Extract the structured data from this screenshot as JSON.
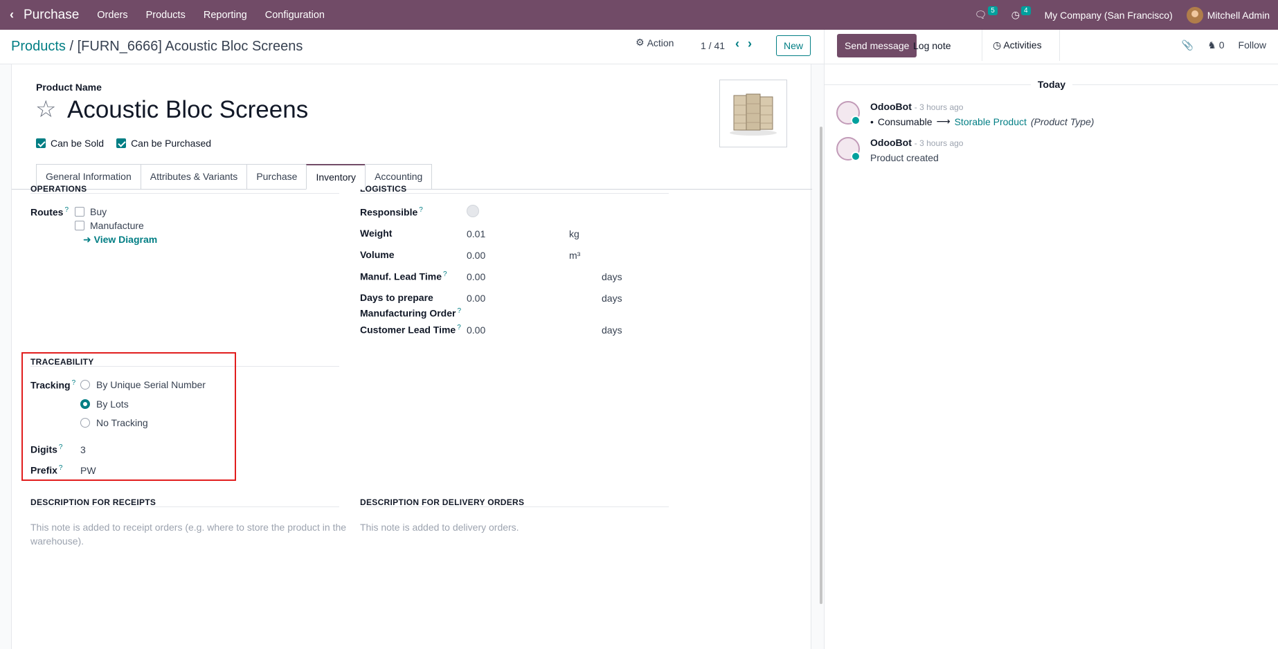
{
  "navbar": {
    "app_name": "Purchase",
    "menu": [
      "Orders",
      "Products",
      "Reporting",
      "Configuration"
    ],
    "messages_count": "5",
    "activities_count": "4",
    "company": "My Company (San Francisco)",
    "user": "Mitchell Admin"
  },
  "control": {
    "breadcrumb_parent": "Products",
    "breadcrumb_separator": "/",
    "breadcrumb_current": "[FURN_6666] Acoustic Bloc Screens",
    "action_label": "Action",
    "pager": "1 / 41",
    "new_label": "New"
  },
  "product": {
    "name_label": "Product Name",
    "name": "Acoustic Bloc Screens",
    "can_be_sold": "Can be Sold",
    "can_be_purchased": "Can be Purchased"
  },
  "tabs": [
    "General Information",
    "Attributes & Variants",
    "Purchase",
    "Inventory",
    "Accounting"
  ],
  "operations": {
    "title": "OPERATIONS",
    "routes_label": "Routes",
    "route_buy": "Buy",
    "route_manufacture": "Manufacture",
    "view_diagram": "View Diagram"
  },
  "logistics": {
    "title": "LOGISTICS",
    "responsible_label": "Responsible",
    "weight_label": "Weight",
    "weight_value": "0.01",
    "weight_unit": "kg",
    "volume_label": "Volume",
    "volume_value": "0.00",
    "volume_unit": "m³",
    "manuf_lead_label": "Manuf. Lead Time",
    "manuf_lead_value": "0.00",
    "days": "days",
    "days_prepare_label_1": "Days to prepare",
    "days_prepare_label_2": "Manufacturing Order",
    "days_prepare_value": "0.00",
    "customer_lead_label": "Customer Lead Time",
    "customer_lead_value": "0.00"
  },
  "traceability": {
    "title": "TRACEABILITY",
    "tracking_label": "Tracking",
    "opt_serial": "By Unique Serial Number",
    "opt_lots": "By Lots",
    "opt_none": "No Tracking",
    "digits_label": "Digits",
    "digits_value": "3",
    "prefix_label": "Prefix",
    "prefix_value": "PW"
  },
  "descriptions": {
    "receipts_title": "DESCRIPTION FOR RECEIPTS",
    "receipts_placeholder_1": "This note is added to receipt orders (e.g. where to store the product in the",
    "receipts_placeholder_2": "warehouse).",
    "delivery_title": "DESCRIPTION FOR DELIVERY ORDERS",
    "delivery_placeholder": "This note is added to delivery orders."
  },
  "chatter": {
    "send_message": "Send message",
    "log_note": "Log note",
    "activities": "Activities",
    "attachments_count": "0",
    "follow": "Follow",
    "today": "Today",
    "messages": [
      {
        "author": "OdooBot",
        "time": "- 3 hours ago",
        "old_value": "Consumable",
        "new_value": "Storable Product",
        "field": "(Product Type)"
      },
      {
        "author": "OdooBot",
        "time": "- 3 hours ago",
        "body": "Product created"
      }
    ]
  }
}
